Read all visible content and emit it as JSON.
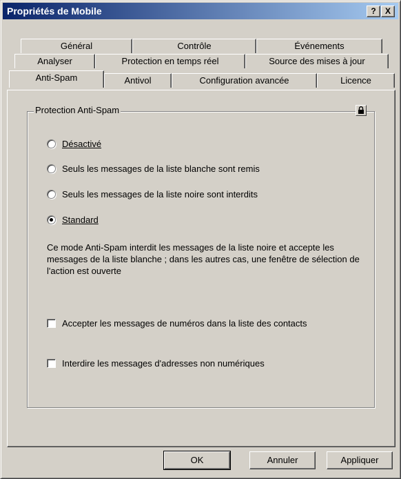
{
  "window": {
    "title": "Propriétés de Mobile",
    "help_label": "?",
    "close_label": "X"
  },
  "tabs": {
    "row1": [
      {
        "label": "Général"
      },
      {
        "label": "Contrôle"
      },
      {
        "label": "Événements"
      }
    ],
    "row2": [
      {
        "label": "Analyser"
      },
      {
        "label": "Protection en temps réel"
      },
      {
        "label": "Source des mises à jour"
      }
    ],
    "row3": [
      {
        "label": "Anti-Spam",
        "active": true
      },
      {
        "label": "Antivol"
      },
      {
        "label": "Configuration avancée"
      },
      {
        "label": "Licence"
      }
    ]
  },
  "group": {
    "title": "Protection Anti-Spam",
    "radios": [
      {
        "label": "Désactivé",
        "checked": false
      },
      {
        "label": "Seuls les messages de la liste blanche sont remis",
        "checked": false
      },
      {
        "label": "Seuls les messages de la liste noire sont interdits",
        "checked": false
      },
      {
        "label": "Standard",
        "checked": true
      }
    ],
    "description": "Ce mode Anti-Spam interdit les messages de la liste noire et accepte les messages de la liste blanche ; dans les autres cas, une fenêtre de sélection de l'action est ouverte",
    "checkboxes": [
      {
        "label": "Accepter les messages de numéros dans la liste des contacts",
        "checked": false
      },
      {
        "label": "Interdire les messages d'adresses non numériques",
        "checked": false
      }
    ]
  },
  "buttons": {
    "ok": "OK",
    "cancel": "Annuler",
    "apply": "Appliquer"
  }
}
